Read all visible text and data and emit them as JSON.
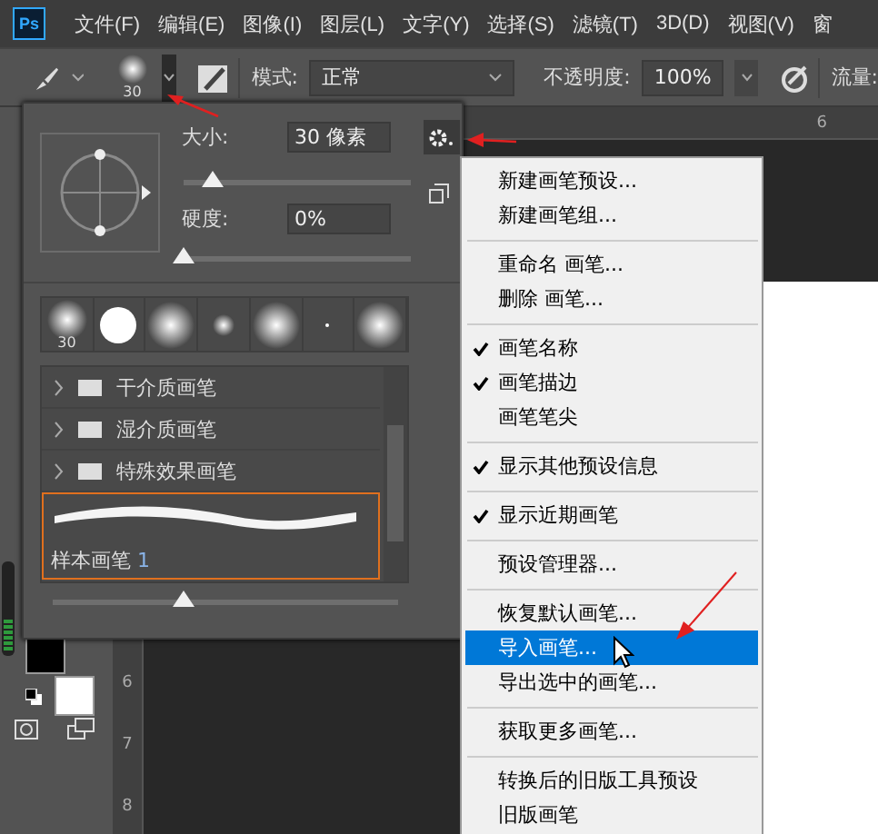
{
  "menu_bar": {
    "app_icon": "Ps",
    "items": [
      "文件(F)",
      "编辑(E)",
      "图像(I)",
      "图层(L)",
      "文字(Y)",
      "选择(S)",
      "滤镜(T)",
      "3D(D)",
      "视图(V)",
      "窗"
    ]
  },
  "options_bar": {
    "brush_size": "30",
    "mode_label": "模式:",
    "mode_value": "正常",
    "opacity_label": "不透明度:",
    "opacity_value": "100%",
    "flow_label": "流量:"
  },
  "brush_panel": {
    "size": {
      "label": "大小:",
      "value": "30 像素",
      "level": 0.13
    },
    "hardness": {
      "label": "硬度:",
      "value": "0%",
      "level": 0
    },
    "presets": [
      {
        "kind": "soft",
        "label": "30"
      },
      {
        "kind": "hard"
      },
      {
        "kind": "soft-large"
      },
      {
        "kind": "soft-small"
      },
      {
        "kind": "soft-large"
      },
      {
        "kind": "dot"
      },
      {
        "kind": "soft-large"
      }
    ],
    "groups": [
      {
        "name": "干介质画笔"
      },
      {
        "name": "湿介质画笔"
      },
      {
        "name": "特殊效果画笔"
      }
    ],
    "brush": {
      "name": "样本画笔",
      "badge": "1",
      "selected": true
    },
    "preview": {
      "level": 0.38
    }
  },
  "vertical_ruler": [
    "6",
    "7",
    "8"
  ],
  "horizontal_ruler": [
    "6"
  ],
  "context_menu": {
    "groups": [
      [
        {
          "label": "新建画笔预设...",
          "checked": false,
          "selected": false
        },
        {
          "label": "新建画笔组...",
          "checked": false,
          "selected": false
        }
      ],
      [
        {
          "label": "重命名 画笔...",
          "checked": false,
          "selected": false
        },
        {
          "label": "删除 画笔...",
          "checked": false,
          "selected": false
        }
      ],
      [
        {
          "label": "画笔名称",
          "checked": true,
          "selected": false
        },
        {
          "label": "画笔描边",
          "checked": true,
          "selected": false
        },
        {
          "label": "画笔笔尖",
          "checked": false,
          "selected": false
        }
      ],
      [
        {
          "label": "显示其他预设信息",
          "checked": true,
          "selected": false
        }
      ],
      [
        {
          "label": "显示近期画笔",
          "checked": true,
          "selected": false
        }
      ],
      [
        {
          "label": "预设管理器...",
          "checked": false,
          "selected": false
        }
      ],
      [
        {
          "label": "恢复默认画笔...",
          "checked": false,
          "selected": false
        },
        {
          "label": "导入画笔...",
          "checked": false,
          "selected": true
        },
        {
          "label": "导出选中的画笔...",
          "checked": false,
          "selected": false
        }
      ],
      [
        {
          "label": "获取更多画笔...",
          "checked": false,
          "selected": false
        }
      ],
      [
        {
          "label": "转换后的旧版工具预设",
          "checked": false,
          "selected": false
        },
        {
          "label": "旧版画笔",
          "checked": false,
          "selected": false
        }
      ]
    ]
  }
}
